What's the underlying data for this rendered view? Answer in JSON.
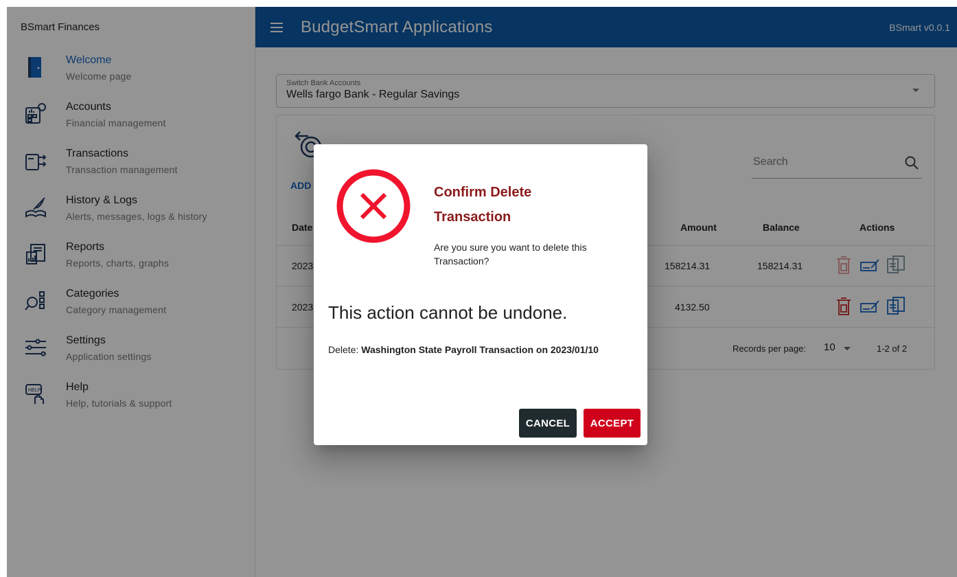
{
  "sidebar": {
    "title": "BSmart Finances",
    "items": [
      {
        "label": "Welcome",
        "sub": "Welcome page",
        "icon": "door-icon"
      },
      {
        "label": "Accounts",
        "sub": "Financial management",
        "icon": "accounts-calculator-icon"
      },
      {
        "label": "Transactions",
        "sub": "Transaction management",
        "icon": "wallet-transfer-icon"
      },
      {
        "label": "History & Logs",
        "sub": "Alerts, messages, logs & history",
        "icon": "book-quill-icon"
      },
      {
        "label": "Reports",
        "sub": "Reports, charts, graphs",
        "icon": "report-chart-icon"
      },
      {
        "label": "Categories",
        "sub": "Category management",
        "icon": "category-search-icon"
      },
      {
        "label": "Settings",
        "sub": "Application settings",
        "icon": "sliders-icon"
      },
      {
        "label": "Help",
        "sub": "Help, tutorials & support",
        "icon": "help-hand-icon"
      }
    ]
  },
  "header": {
    "title": "BudgetSmart Applications",
    "version": "BSmart v0.0.1"
  },
  "account_select": {
    "label": "Switch Bank Accounts",
    "value": "Wells fargo Bank - Regular Savings"
  },
  "panel": {
    "add_label": "ADD",
    "search_placeholder": "Search",
    "columns": {
      "date": "Date",
      "amount": "Amount",
      "balance": "Balance",
      "actions": "Actions"
    },
    "rows": [
      {
        "date": "2023",
        "amount": "158214.31",
        "balance": "158214.31"
      },
      {
        "date": "2023",
        "amount": "4132.50",
        "balance": ""
      }
    ],
    "pager": {
      "label": "Records per page:",
      "per_page": "10",
      "range": "1-2 of 2"
    }
  },
  "dialog": {
    "title": "Confirm Delete Transaction",
    "question": "Are you sure you want to delete this Transaction?",
    "warning": "This action cannot be undone.",
    "detail_prefix": "Delete: ",
    "detail_bold": "Washington State Payroll Transaction on 2023/01/10",
    "cancel_label": "CANCEL",
    "accept_label": "ACCEPT"
  },
  "colors": {
    "appbar": "#0d5aa7",
    "accent_blue": "#1565c0",
    "danger": "#d0021b",
    "title_red": "#8b1a1a",
    "cancel_dark": "#1f2b2e"
  }
}
